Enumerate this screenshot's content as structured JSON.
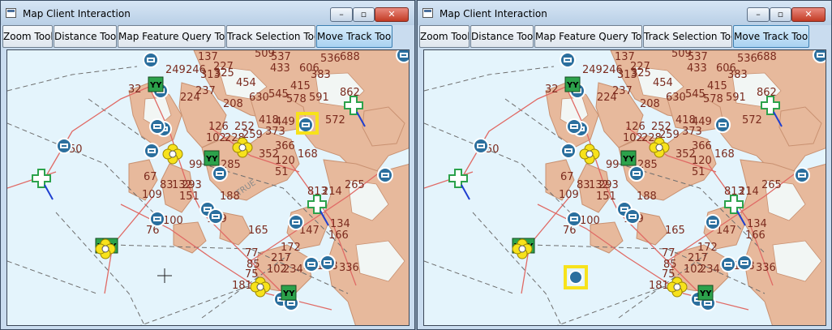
{
  "window": {
    "title": "Map Client Interaction",
    "controls": {
      "minimize": "–",
      "maximize": "▫",
      "close": "✕"
    }
  },
  "toolbar": {
    "buttons": [
      "Zoom Tool",
      "Distance Tool",
      "Map Feature Query Tool",
      "Track Selection Tool",
      "Move Track Tool"
    ]
  },
  "map": {
    "track_labels": [
      "249",
      "246",
      "313",
      "325",
      "237",
      "224",
      "137",
      "227",
      "454",
      "509",
      "537",
      "433",
      "606",
      "536",
      "688",
      "383",
      "415",
      "578",
      "591",
      "862",
      "208",
      "630",
      "545",
      "126",
      "102",
      "228",
      "252",
      "259",
      "418",
      "449",
      "373",
      "366",
      "572",
      "99",
      "285",
      "352",
      "120",
      "168",
      "51",
      "67",
      "109",
      "83",
      "132",
      "293",
      "151",
      "188",
      "50",
      "813",
      "214",
      "265",
      "100",
      "76",
      "129",
      "165",
      "147",
      "134",
      "166",
      "172",
      "77",
      "85",
      "75",
      "217",
      "102",
      "234",
      "381",
      "38",
      "336",
      "32",
      "181"
    ],
    "left_overlay": {
      "range_label": "TRUE"
    },
    "symbols": {
      "hostile": "YY"
    }
  },
  "colors": {
    "water": "#e4f4fc",
    "land": "#e7b99c",
    "land_dark": "#c99171",
    "ice": "#f2f6f4",
    "road": "#e06a65",
    "boundary": "#6f6f6f",
    "label": "#7b2b1e",
    "track_blue": "#2b6f9e",
    "friendly_green": "#2ca24b",
    "hostile_yellow": "#f7e21b",
    "accent": "#3c7fb1"
  }
}
